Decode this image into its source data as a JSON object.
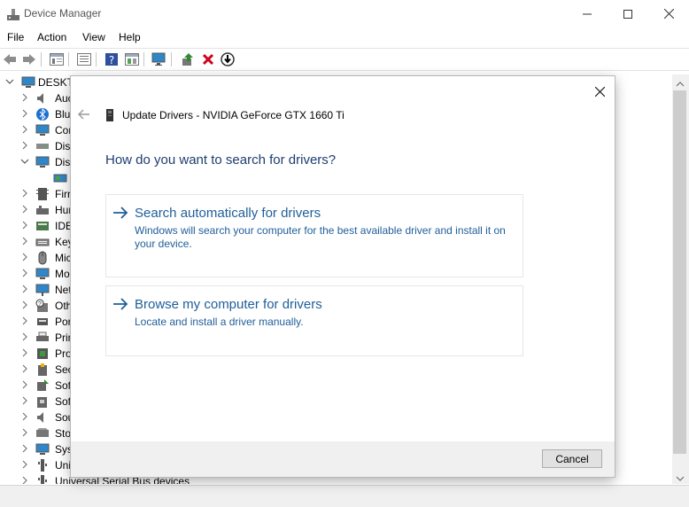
{
  "window": {
    "title": "Device Manager"
  },
  "menu": [
    "File",
    "Action",
    "View",
    "Help"
  ],
  "tree": {
    "root": "DESKTO",
    "items": [
      {
        "label": "Auc",
        "icon": "speaker-icon",
        "expanded": false
      },
      {
        "label": "Blu",
        "icon": "bluetooth-icon",
        "expanded": false
      },
      {
        "label": "Cor",
        "icon": "computer-icon",
        "expanded": false
      },
      {
        "label": "Disl",
        "icon": "disk-drive-icon",
        "expanded": false
      },
      {
        "label": "Disp",
        "icon": "monitor-icon",
        "expanded": true
      },
      {
        "label": "",
        "icon": "display-adapter-icon",
        "child": true
      },
      {
        "label": "Firr",
        "icon": "firmware-icon",
        "expanded": false
      },
      {
        "label": "Hur",
        "icon": "hid-icon",
        "expanded": false
      },
      {
        "label": "IDE",
        "icon": "ide-icon",
        "expanded": false
      },
      {
        "label": "Key",
        "icon": "keyboard-icon",
        "expanded": false
      },
      {
        "label": "Mic",
        "icon": "mouse-icon",
        "expanded": false
      },
      {
        "label": "Mo",
        "icon": "monitor-icon",
        "expanded": false
      },
      {
        "label": "Net",
        "icon": "network-icon",
        "expanded": false
      },
      {
        "label": "Oth",
        "icon": "other-devices-icon",
        "expanded": false
      },
      {
        "label": "Por",
        "icon": "port-icon",
        "expanded": false
      },
      {
        "label": "Prir",
        "icon": "printer-icon",
        "expanded": false
      },
      {
        "label": "Pro",
        "icon": "processor-icon",
        "expanded": false
      },
      {
        "label": "Sec",
        "icon": "security-icon",
        "expanded": false
      },
      {
        "label": "Sof",
        "icon": "software-component-icon",
        "expanded": false
      },
      {
        "label": "Sof",
        "icon": "software-device-icon",
        "expanded": false
      },
      {
        "label": "Sou",
        "icon": "speaker-icon",
        "expanded": false
      },
      {
        "label": "Sto",
        "icon": "storage-icon",
        "expanded": false
      },
      {
        "label": "Sys",
        "icon": "system-icon",
        "expanded": false
      },
      {
        "label": "Uni",
        "icon": "usb-icon",
        "expanded": false
      },
      {
        "label": "Universal Serial Bus devices",
        "icon": "usb-icon",
        "expanded": false
      }
    ]
  },
  "dialog": {
    "title": "Update Drivers - NVIDIA GeForce GTX 1660 Ti",
    "question": "How do you want to search for drivers?",
    "options": [
      {
        "title": "Search automatically for drivers",
        "description": "Windows will search your computer for the best available driver and install it on your device."
      },
      {
        "title": "Browse my computer for drivers",
        "description": "Locate and install a driver manually."
      }
    ],
    "cancel_label": "Cancel"
  },
  "colors": {
    "link": "#1f5e9a",
    "heading": "#1e3d6e",
    "delete": "#d0021b",
    "enable": "#2e8b2e"
  }
}
